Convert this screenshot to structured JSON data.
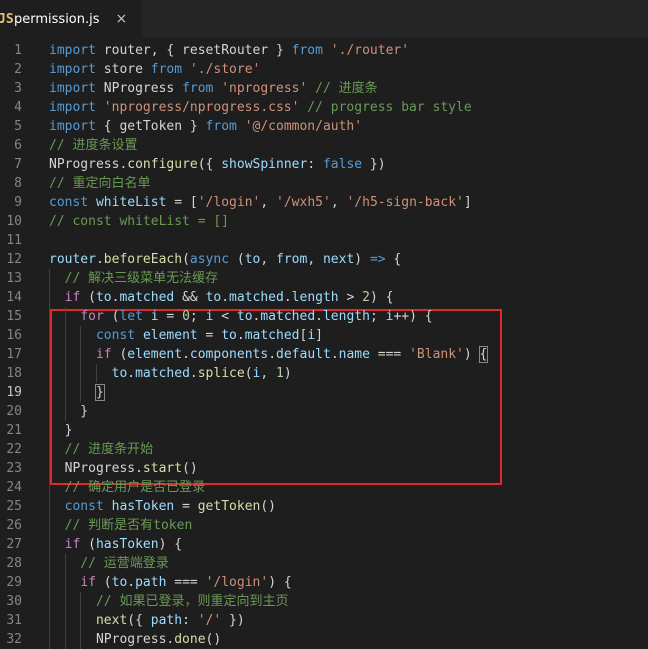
{
  "tab": {
    "icon": "JS",
    "label": "permission.js",
    "close": "×"
  },
  "active_line": 19,
  "lines": [
    {
      "n": "1",
      "tokens": [
        [
          "kw",
          "import"
        ],
        [
          "op",
          " router, { resetRouter } "
        ],
        [
          "kw",
          "from"
        ],
        [
          "op",
          " "
        ],
        [
          "str",
          "'./router'"
        ]
      ]
    },
    {
      "n": "2",
      "tokens": [
        [
          "kw",
          "import"
        ],
        [
          "op",
          " store "
        ],
        [
          "kw",
          "from"
        ],
        [
          "op",
          " "
        ],
        [
          "str",
          "'./store'"
        ]
      ]
    },
    {
      "n": "3",
      "tokens": [
        [
          "kw",
          "import"
        ],
        [
          "op",
          " NProgress "
        ],
        [
          "kw",
          "from"
        ],
        [
          "op",
          " "
        ],
        [
          "str",
          "'nprogress'"
        ],
        [
          "cmt",
          " // 进度条"
        ]
      ]
    },
    {
      "n": "4",
      "tokens": [
        [
          "kw",
          "import"
        ],
        [
          "op",
          " "
        ],
        [
          "str",
          "'nprogress/nprogress.css'"
        ],
        [
          "cmt",
          " // progress bar style"
        ]
      ]
    },
    {
      "n": "5",
      "tokens": [
        [
          "kw",
          "import"
        ],
        [
          "op",
          " { getToken } "
        ],
        [
          "kw",
          "from"
        ],
        [
          "op",
          " "
        ],
        [
          "str",
          "'@/common/auth'"
        ]
      ]
    },
    {
      "n": "6",
      "tokens": [
        [
          "cmt",
          "// 进度条设置"
        ]
      ]
    },
    {
      "n": "7",
      "tokens": [
        [
          "op",
          "NProgress."
        ],
        [
          "fn",
          "configure"
        ],
        [
          "op",
          "({ "
        ],
        [
          "var",
          "showSpinner"
        ],
        [
          "op",
          ": "
        ],
        [
          "kw",
          "false"
        ],
        [
          "op",
          " })"
        ]
      ]
    },
    {
      "n": "8",
      "tokens": [
        [
          "cmt",
          "// 重定向白名单"
        ]
      ]
    },
    {
      "n": "9",
      "tokens": [
        [
          "kw",
          "const"
        ],
        [
          "op",
          " "
        ],
        [
          "var",
          "whiteList"
        ],
        [
          "op",
          " = ["
        ],
        [
          "str",
          "'/login'"
        ],
        [
          "op",
          ", "
        ],
        [
          "str",
          "'/wxh5'"
        ],
        [
          "op",
          ", "
        ],
        [
          "str",
          "'/h5-sign-back'"
        ],
        [
          "op",
          "]"
        ]
      ]
    },
    {
      "n": "10",
      "tokens": [
        [
          "cmt",
          "// const whiteList = []"
        ]
      ]
    },
    {
      "n": "11",
      "tokens": []
    },
    {
      "n": "12",
      "tokens": [
        [
          "var",
          "router"
        ],
        [
          "op",
          "."
        ],
        [
          "fn",
          "beforeEach"
        ],
        [
          "op",
          "("
        ],
        [
          "kw",
          "async"
        ],
        [
          "op",
          " ("
        ],
        [
          "var",
          "to"
        ],
        [
          "op",
          ", "
        ],
        [
          "var",
          "from"
        ],
        [
          "op",
          ", "
        ],
        [
          "var",
          "next"
        ],
        [
          "op",
          ") "
        ],
        [
          "kw",
          "=>"
        ],
        [
          "op",
          " {"
        ]
      ]
    },
    {
      "n": "13",
      "tokens": [
        [
          "op",
          "  "
        ],
        [
          "cmt",
          "// 解决三级菜单无法缓存"
        ]
      ]
    },
    {
      "n": "14",
      "tokens": [
        [
          "op",
          "  "
        ],
        [
          "ctl",
          "if"
        ],
        [
          "op",
          " ("
        ],
        [
          "var",
          "to"
        ],
        [
          "op",
          "."
        ],
        [
          "var",
          "matched"
        ],
        [
          "op",
          " && "
        ],
        [
          "var",
          "to"
        ],
        [
          "op",
          "."
        ],
        [
          "var",
          "matched"
        ],
        [
          "op",
          "."
        ],
        [
          "var",
          "length"
        ],
        [
          "op",
          " > "
        ],
        [
          "num",
          "2"
        ],
        [
          "op",
          ") {"
        ]
      ]
    },
    {
      "n": "15",
      "tokens": [
        [
          "op",
          "    "
        ],
        [
          "ctl",
          "for"
        ],
        [
          "op",
          " ("
        ],
        [
          "kw",
          "let"
        ],
        [
          "op",
          " "
        ],
        [
          "var",
          "i"
        ],
        [
          "op",
          " = "
        ],
        [
          "num",
          "0"
        ],
        [
          "op",
          "; "
        ],
        [
          "var",
          "i"
        ],
        [
          "op",
          " < "
        ],
        [
          "var",
          "to"
        ],
        [
          "op",
          "."
        ],
        [
          "var",
          "matched"
        ],
        [
          "op",
          "."
        ],
        [
          "var",
          "length"
        ],
        [
          "op",
          "; "
        ],
        [
          "var",
          "i"
        ],
        [
          "op",
          "++) {"
        ]
      ]
    },
    {
      "n": "16",
      "tokens": [
        [
          "op",
          "      "
        ],
        [
          "kw",
          "const"
        ],
        [
          "op",
          " "
        ],
        [
          "var",
          "element"
        ],
        [
          "op",
          " = "
        ],
        [
          "var",
          "to"
        ],
        [
          "op",
          "."
        ],
        [
          "var",
          "matched"
        ],
        [
          "op",
          "["
        ],
        [
          "var",
          "i"
        ],
        [
          "op",
          "]"
        ]
      ]
    },
    {
      "n": "17",
      "tokens": [
        [
          "op",
          "      "
        ],
        [
          "ctl",
          "if"
        ],
        [
          "op",
          " ("
        ],
        [
          "var",
          "element"
        ],
        [
          "op",
          "."
        ],
        [
          "var",
          "components"
        ],
        [
          "op",
          "."
        ],
        [
          "var",
          "default"
        ],
        [
          "op",
          "."
        ],
        [
          "var",
          "name"
        ],
        [
          "op",
          " === "
        ],
        [
          "str",
          "'Blank'"
        ],
        [
          "op",
          ") "
        ],
        [
          "br",
          "{"
        ]
      ]
    },
    {
      "n": "18",
      "tokens": [
        [
          "op",
          "        "
        ],
        [
          "var",
          "to"
        ],
        [
          "op",
          "."
        ],
        [
          "var",
          "matched"
        ],
        [
          "op",
          "."
        ],
        [
          "fn",
          "splice"
        ],
        [
          "op",
          "("
        ],
        [
          "var",
          "i"
        ],
        [
          "op",
          ", "
        ],
        [
          "num",
          "1"
        ],
        [
          "op",
          ")"
        ]
      ]
    },
    {
      "n": "19",
      "tokens": [
        [
          "op",
          "      "
        ],
        [
          "br",
          "}"
        ]
      ]
    },
    {
      "n": "20",
      "tokens": [
        [
          "op",
          "    }"
        ]
      ]
    },
    {
      "n": "21",
      "tokens": [
        [
          "op",
          "  }"
        ]
      ]
    },
    {
      "n": "22",
      "tokens": [
        [
          "op",
          "  "
        ],
        [
          "cmt",
          "// 进度条开始"
        ]
      ]
    },
    {
      "n": "23",
      "tokens": [
        [
          "op",
          "  NProgress."
        ],
        [
          "fn",
          "start"
        ],
        [
          "op",
          "()"
        ]
      ]
    },
    {
      "n": "24",
      "tokens": [
        [
          "op",
          "  "
        ],
        [
          "cmt",
          "// 确定用户是否已登录"
        ]
      ]
    },
    {
      "n": "25",
      "tokens": [
        [
          "op",
          "  "
        ],
        [
          "kw",
          "const"
        ],
        [
          "op",
          " "
        ],
        [
          "var",
          "hasToken"
        ],
        [
          "op",
          " = "
        ],
        [
          "fn",
          "getToken"
        ],
        [
          "op",
          "()"
        ]
      ]
    },
    {
      "n": "26",
      "tokens": [
        [
          "op",
          "  "
        ],
        [
          "cmt",
          "// 判断是否有token"
        ]
      ]
    },
    {
      "n": "27",
      "tokens": [
        [
          "op",
          "  "
        ],
        [
          "ctl",
          "if"
        ],
        [
          "op",
          " ("
        ],
        [
          "var",
          "hasToken"
        ],
        [
          "op",
          ") {"
        ]
      ]
    },
    {
      "n": "28",
      "tokens": [
        [
          "op",
          "    "
        ],
        [
          "cmt",
          "// 运营端登录"
        ]
      ]
    },
    {
      "n": "29",
      "tokens": [
        [
          "op",
          "    "
        ],
        [
          "ctl",
          "if"
        ],
        [
          "op",
          " ("
        ],
        [
          "var",
          "to"
        ],
        [
          "op",
          "."
        ],
        [
          "var",
          "path"
        ],
        [
          "op",
          " === "
        ],
        [
          "str",
          "'/login'"
        ],
        [
          "op",
          ") {"
        ]
      ]
    },
    {
      "n": "30",
      "tokens": [
        [
          "op",
          "      "
        ],
        [
          "cmt",
          "// 如果已登录，则重定向到主页"
        ]
      ]
    },
    {
      "n": "31",
      "tokens": [
        [
          "op",
          "      "
        ],
        [
          "fn",
          "next"
        ],
        [
          "op",
          "({ "
        ],
        [
          "var",
          "path"
        ],
        [
          "op",
          ": "
        ],
        [
          "str",
          "'/'"
        ],
        [
          "op",
          " })"
        ]
      ]
    },
    {
      "n": "32",
      "tokens": [
        [
          "op",
          "      NProgress."
        ],
        [
          "fn",
          "done"
        ],
        [
          "op",
          "()"
        ]
      ]
    }
  ]
}
